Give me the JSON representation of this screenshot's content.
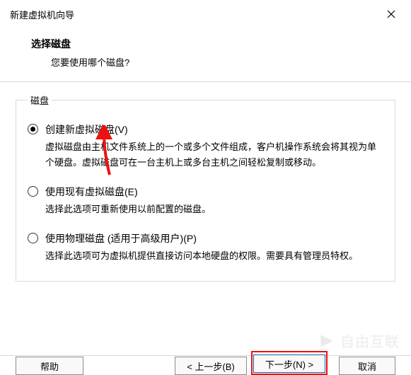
{
  "window": {
    "title": "新建虚拟机向导"
  },
  "header": {
    "title": "选择磁盘",
    "subtitle": "您要使用哪个磁盘?"
  },
  "group": {
    "legend": "磁盘",
    "options": [
      {
        "label": "创建新虚拟磁盘(V)",
        "desc": "虚拟磁盘由主机文件系统上的一个或多个文件组成，客户机操作系统会将其视为单个硬盘。虚拟磁盘可在一台主机上或多台主机之间轻松复制或移动。",
        "selected": true
      },
      {
        "label": "使用现有虚拟磁盘(E)",
        "desc": "选择此选项可重新使用以前配置的磁盘。",
        "selected": false
      },
      {
        "label": "使用物理磁盘 (适用于高级用户)(P)",
        "desc": "选择此选项可为虚拟机提供直接访问本地硬盘的权限。需要具有管理员特权。",
        "selected": false
      }
    ]
  },
  "footer": {
    "help": "帮助",
    "back": "< 上一步(B)",
    "next": "下一步(N) >",
    "cancel": "取消"
  },
  "watermark": "自由互联"
}
